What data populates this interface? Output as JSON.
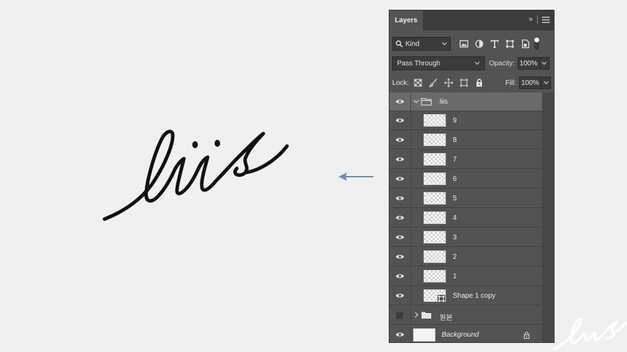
{
  "canvas": {
    "artwork_text": "liis",
    "watermark_text": "liis",
    "arrow_color": "#6b8fb8"
  },
  "panel": {
    "tab_label": "Layers",
    "filter": {
      "kind_label": "Kind"
    },
    "blend_mode": "Pass Through",
    "opacity_label": "Opacity:",
    "opacity_value": "100%",
    "lock_label": "Lock:",
    "fill_label": "Fill:",
    "fill_value": "100%",
    "layers": [
      {
        "name": "liis",
        "type": "group",
        "expanded": true,
        "selected": true,
        "visible": true
      },
      {
        "name": "9",
        "type": "pixel",
        "visible": true
      },
      {
        "name": "8",
        "type": "pixel",
        "visible": true
      },
      {
        "name": "7",
        "type": "pixel",
        "visible": true
      },
      {
        "name": "6",
        "type": "pixel",
        "visible": true
      },
      {
        "name": "5",
        "type": "pixel",
        "visible": true
      },
      {
        "name": "4",
        "type": "pixel",
        "visible": true
      },
      {
        "name": "3",
        "type": "pixel",
        "visible": true
      },
      {
        "name": "2",
        "type": "pixel",
        "visible": true
      },
      {
        "name": "1",
        "type": "pixel",
        "visible": true
      },
      {
        "name": "Shape 1 copy",
        "type": "shape",
        "visible": true
      },
      {
        "name": "원본",
        "type": "group",
        "expanded": false,
        "visible": false
      },
      {
        "name": "Background",
        "type": "background",
        "visible": true,
        "locked": true
      }
    ]
  }
}
